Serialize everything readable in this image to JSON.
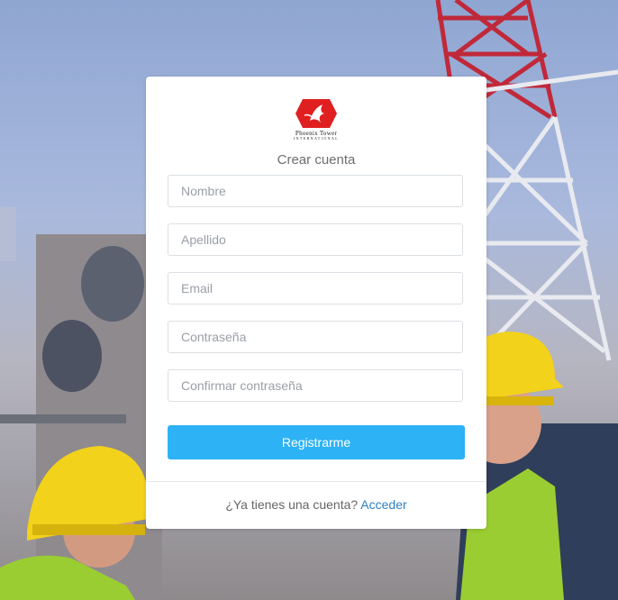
{
  "brand": {
    "name_line1": "Phoenix Tower",
    "name_line2": "INTERNATIONAL",
    "logo_color": "#e02020"
  },
  "form": {
    "title": "Crear cuenta",
    "fields": [
      {
        "placeholder": "Nombre",
        "value": ""
      },
      {
        "placeholder": "Apellido",
        "value": ""
      },
      {
        "placeholder": "Email",
        "value": ""
      },
      {
        "placeholder": "Contraseña",
        "value": ""
      },
      {
        "placeholder": "Confirmar contraseña",
        "value": ""
      }
    ],
    "submit_label": "Registrarme",
    "accent_color": "#2db2f5"
  },
  "footer": {
    "prompt": "¿Ya tienes una cuenta?",
    "link_label": "Acceder"
  }
}
